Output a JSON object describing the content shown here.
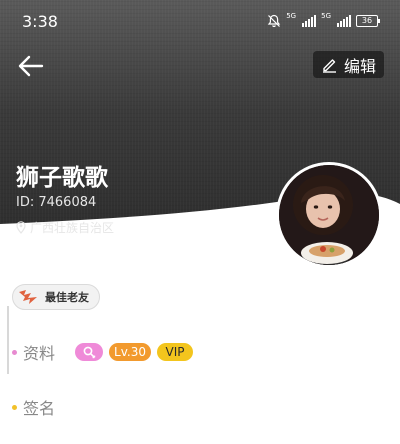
{
  "status_bar": {
    "time": "3:38",
    "signal_1_label": "5G",
    "signal_2_label": "5G",
    "battery": "36"
  },
  "header": {
    "edit_label": "编辑"
  },
  "profile": {
    "name": "狮子歌歌",
    "id_text": "ID: 7466084",
    "location": "广西壮族自治区"
  },
  "badge": {
    "label": "最佳老友"
  },
  "info": {
    "ziliao_label": "资料",
    "level": "Lv.30",
    "vip": "VIP",
    "signature_label": "签名"
  },
  "colors": {
    "pink_tag": "#ef8ad8",
    "orange_tag": "#f29a2e",
    "yellow_tag": "#f3c51d",
    "pink_dot": "#e78ad0",
    "yellow_dot": "#f2c12a"
  }
}
